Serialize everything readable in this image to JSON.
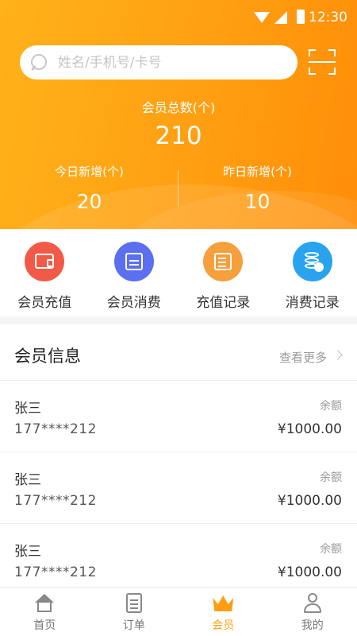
{
  "status_bar": {
    "time": "12:30"
  },
  "search": {
    "placeholder": "姓名/手机号/卡号"
  },
  "summary": {
    "total_label": "会员总数(个)",
    "total_value": "210",
    "today_label": "今日新增(个)",
    "today_value": "20",
    "yesterday_label": "昨日新增(个)",
    "yesterday_value": "10"
  },
  "actions": [
    {
      "label": "会员充值",
      "icon": "wallet-icon",
      "color": "#f25a48"
    },
    {
      "label": "会员消费",
      "icon": "calendar-icon",
      "color": "#5b6ff0"
    },
    {
      "label": "充值记录",
      "icon": "receipt-icon",
      "color": "#f5a03d"
    },
    {
      "label": "消费记录",
      "icon": "coins-clock-icon",
      "color": "#2aa3ef"
    }
  ],
  "members": {
    "title": "会员信息",
    "more_label": "查看更多",
    "rows": [
      {
        "name": "张三",
        "phone": "177****212",
        "balance_label": "余额",
        "balance": "¥1000.00"
      },
      {
        "name": "张三",
        "phone": "177****212",
        "balance_label": "余额",
        "balance": "¥1000.00"
      },
      {
        "name": "张三",
        "phone": "177****212",
        "balance_label": "余额",
        "balance": "¥1000.00"
      }
    ]
  },
  "tabbar": {
    "items": [
      {
        "label": "首页",
        "icon": "home-icon"
      },
      {
        "label": "订单",
        "icon": "order-icon"
      },
      {
        "label": "会员",
        "icon": "crown-icon",
        "active": true
      },
      {
        "label": "我的",
        "icon": "user-icon"
      }
    ],
    "active_color": "#ff9e12"
  },
  "colors": {
    "header_start": "#ffb21a",
    "header_end": "#ff8e08"
  }
}
